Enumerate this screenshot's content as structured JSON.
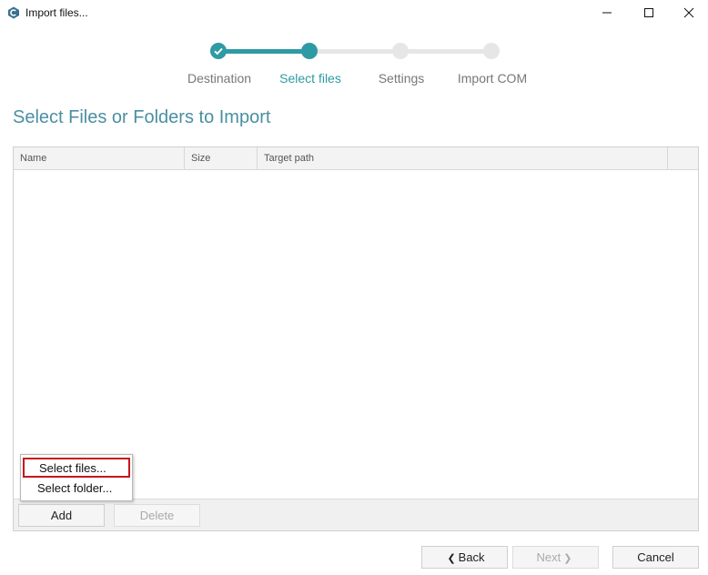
{
  "window": {
    "title": "Import files..."
  },
  "colors": {
    "accent": "#2e9aa4",
    "inactive_step": "#e6e6e6",
    "heading": "#4a8fa3",
    "highlight_border": "#c8151b"
  },
  "stepper": {
    "steps": [
      {
        "label": "Destination",
        "state": "done"
      },
      {
        "label": "Select files",
        "state": "current"
      },
      {
        "label": "Settings",
        "state": "pending"
      },
      {
        "label": "Import COM",
        "state": "pending"
      }
    ]
  },
  "main": {
    "heading": "Select Files or Folders to Import",
    "table": {
      "columns": [
        "Name",
        "Size",
        "Target path"
      ],
      "rows": []
    },
    "actions": {
      "add_label": "Add",
      "delete_label": "Delete"
    },
    "add_menu": {
      "items": [
        "Select files...",
        "Select folder..."
      ]
    }
  },
  "footer": {
    "back_label": "Back",
    "next_label": "Next",
    "cancel_label": "Cancel"
  }
}
